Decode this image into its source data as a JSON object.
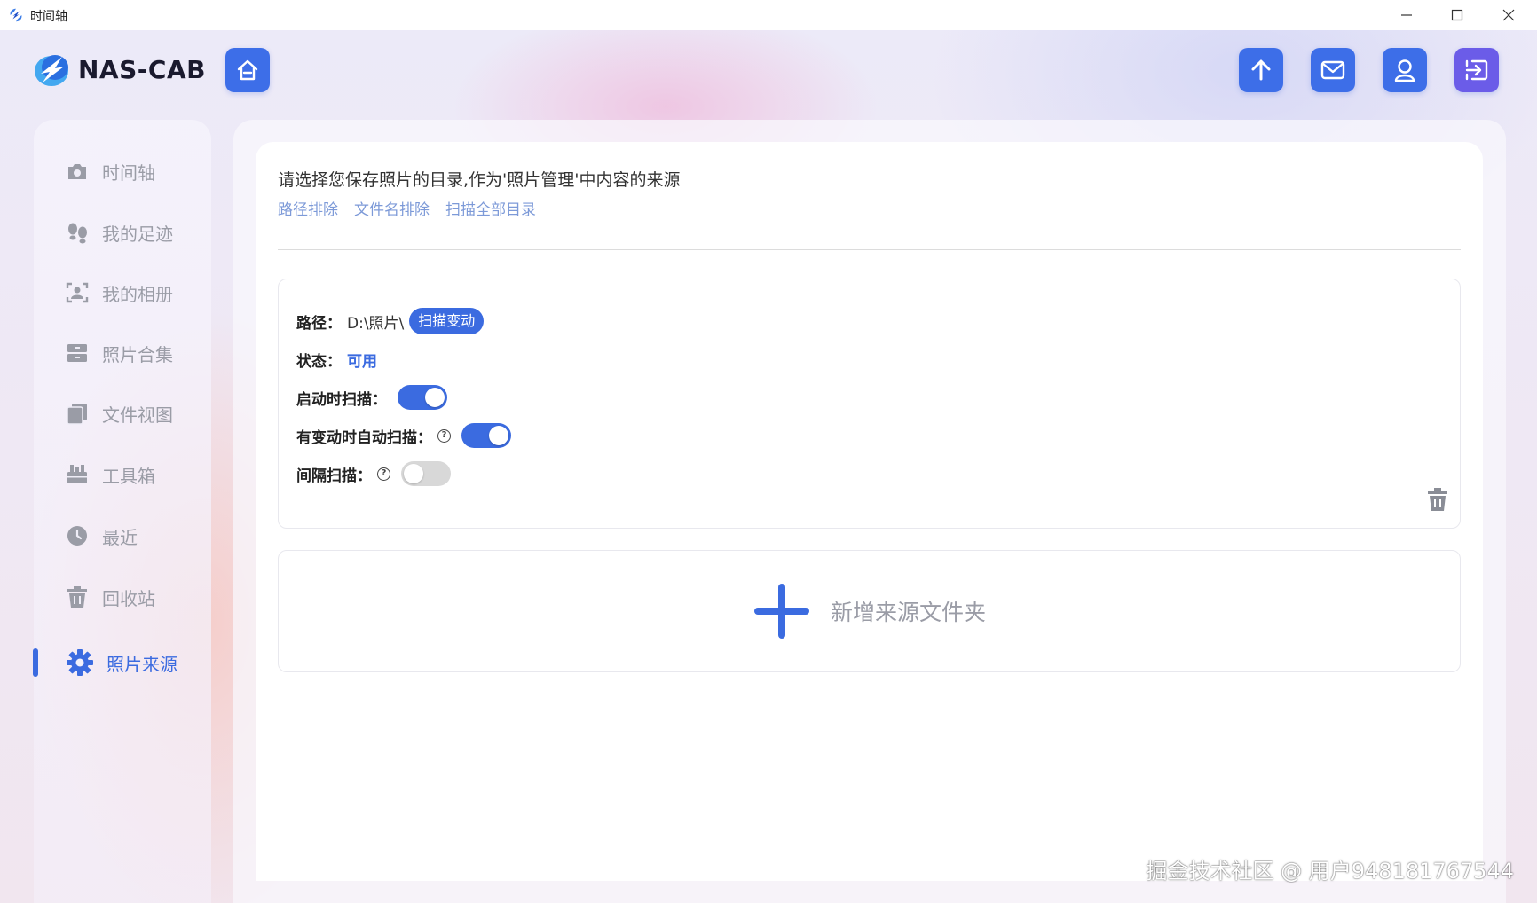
{
  "window": {
    "title": "时间轴",
    "controls": {
      "minimize": "minimize-icon",
      "maximize": "maximize-icon",
      "close": "close-icon"
    }
  },
  "header": {
    "logo_text": "NAS-CAB",
    "buttons": [
      "home-icon",
      "upload-icon",
      "mail-icon",
      "user-icon",
      "logout-icon"
    ]
  },
  "sidebar": {
    "items": [
      {
        "label": "时间轴",
        "icon": "camera-icon"
      },
      {
        "label": "我的足迹",
        "icon": "footprint-icon"
      },
      {
        "label": "我的相册",
        "icon": "face-scan-icon"
      },
      {
        "label": "照片合集",
        "icon": "archive-icon"
      },
      {
        "label": "文件视图",
        "icon": "files-icon"
      },
      {
        "label": "工具箱",
        "icon": "toolbox-icon"
      },
      {
        "label": "最近",
        "icon": "clock-icon"
      },
      {
        "label": "回收站",
        "icon": "trash-icon"
      },
      {
        "label": "照片来源",
        "icon": "gear-icon",
        "active": true
      }
    ]
  },
  "main": {
    "intro": "请选择您保存照片的目录,作为'照片管理'中内容的来源",
    "links": [
      "路径排除",
      "文件名排除",
      "扫描全部目录"
    ],
    "source": {
      "path_label": "路径：",
      "path_value": "D:\\照片\\",
      "scan_changes": "扫描变动",
      "status_label": "状态：",
      "status_value": "可用",
      "scan_on_start_label": "启动时扫描：",
      "scan_on_start": true,
      "auto_scan_label": "有变动时自动扫描：",
      "auto_scan": true,
      "interval_scan_label": "间隔扫描：",
      "interval_scan": false,
      "help_glyph": "?"
    },
    "add_folder": "新增来源文件夹"
  },
  "watermark": "掘金技术社区 @ 用户948181767544",
  "colors": {
    "accent": "#3b6be0",
    "accent_violet": "#6b5ce8",
    "muted": "#9a9ca6"
  }
}
